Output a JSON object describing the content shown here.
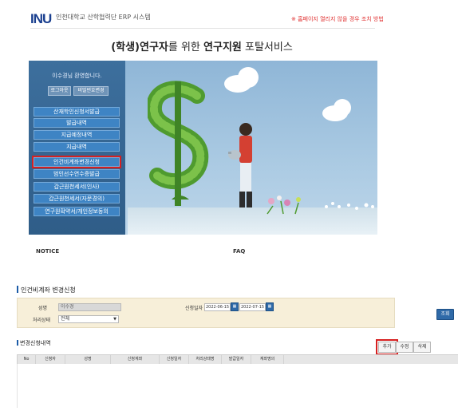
{
  "header": {
    "logo": {
      "letters": "INU"
    },
    "system_name": "인천대학교 산학협력단 ERP 시스템",
    "browser_warning": "※ 홈페이지 열리지 않을 경우 조치 방법"
  },
  "portal_title": {
    "part1": "(학생)연구자",
    "part2": "를 위한 ",
    "part3": "연구지원",
    "part4": " 포탈서비스"
  },
  "banner": {
    "welcome": "이수경님 환영합니다.",
    "logout_label": "로그아웃",
    "password_change_label": "비밀번호변경",
    "menu_items": [
      {
        "label": "산재학인신청서발급"
      },
      {
        "label": "발급내역"
      },
      {
        "label": "지급예정내역"
      },
      {
        "label": "지급내역"
      },
      {
        "label": "인건비계좌변경신청",
        "selected": true
      },
      {
        "label": "범인선수연수증발급"
      },
      {
        "label": "갑근원천세서(인사)"
      },
      {
        "label": "갑근원천세서(자문경의)"
      },
      {
        "label": "연구원확약서/개인정보동의"
      }
    ]
  },
  "notice_label": "NOTICE",
  "faq_label": "FAQ",
  "section": {
    "title": "인건비계좌 변경신청",
    "search": {
      "name_label": "성명",
      "name_value": "이수경",
      "status_label": "처리상태",
      "status_value": "전체",
      "date_label": "신청일자",
      "date_from": "2022-06-15",
      "date_to": "2022-07-15",
      "search_button": "조회"
    },
    "list_title": "변경신청내역",
    "toolbar": {
      "add": "추가",
      "edit": "수정",
      "delete": "삭제"
    },
    "grid_columns": [
      "No",
      "신청자",
      "성명",
      "신청계좌",
      "신청일자",
      "처리상태명",
      "발급일자",
      "계좌명의"
    ]
  },
  "colors": {
    "menu_blue": "#3e84c4",
    "highlight_red": "#d62020",
    "search_bg": "#f7efd9"
  }
}
